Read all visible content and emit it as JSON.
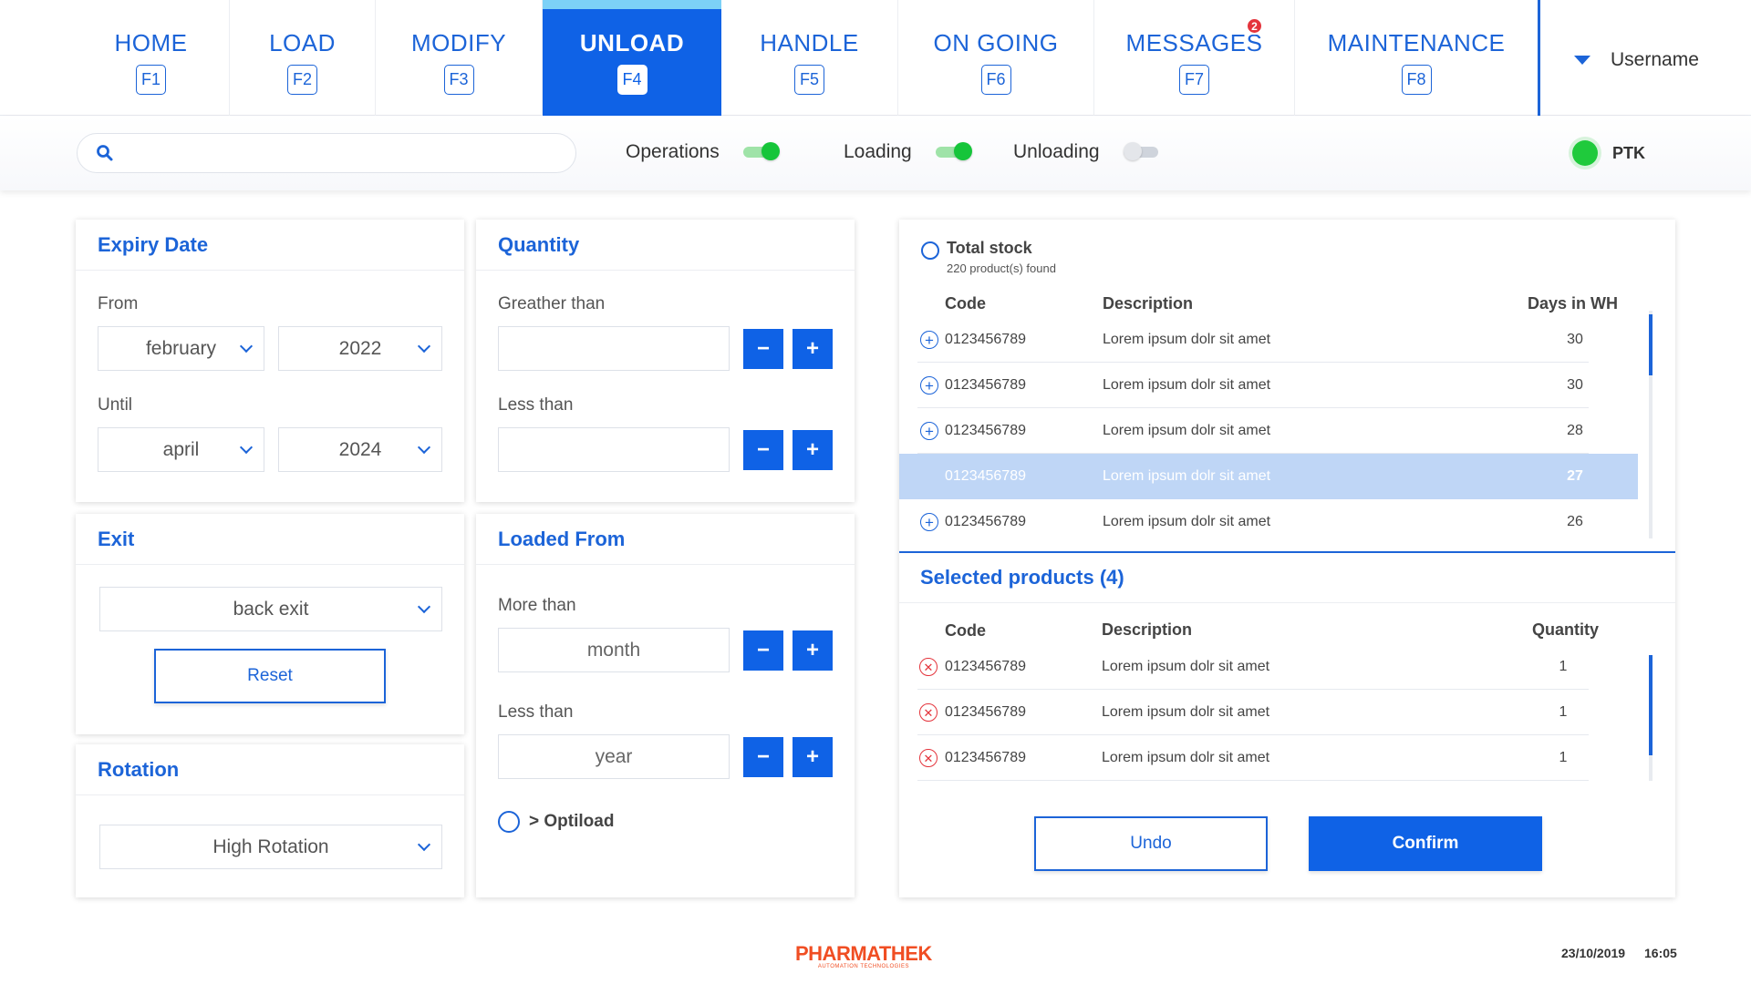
{
  "nav": {
    "tabs": [
      {
        "label": "HOME",
        "key": "F1"
      },
      {
        "label": "LOAD",
        "key": "F2"
      },
      {
        "label": "MODIFY",
        "key": "F3"
      },
      {
        "label": "UNLOAD",
        "key": "F4",
        "active": true
      },
      {
        "label": "HANDLE",
        "key": "F5"
      },
      {
        "label": "ON GOING",
        "key": "F6"
      },
      {
        "label": "MESSAGES",
        "key": "F7",
        "badge": "2"
      },
      {
        "label": "MAINTENANCE",
        "key": "F8"
      }
    ],
    "username": "Username"
  },
  "filterbar": {
    "search_placeholder": "",
    "toggles": [
      {
        "label": "Operations",
        "on": true
      },
      {
        "label": "Loading",
        "on": true
      },
      {
        "label": "Unloading",
        "on": false
      }
    ],
    "status_label": "PTK",
    "status_color": "#1fca3c"
  },
  "expiry": {
    "title": "Expiry Date",
    "from_label": "From",
    "from_month": "february",
    "from_year": "2022",
    "until_label": "Until",
    "until_month": "april",
    "until_year": "2024"
  },
  "quantity": {
    "title": "Quantity",
    "greater_label": "Greather than",
    "greater_value": "",
    "less_label": "Less than",
    "less_value": "",
    "minus": "−",
    "plus": "+"
  },
  "exit": {
    "title": "Exit",
    "value": "back exit",
    "reset_label": "Reset"
  },
  "rotation": {
    "title": "Rotation",
    "value": "High Rotation"
  },
  "loaded_from": {
    "title": "Loaded From",
    "more_label": "More than",
    "more_value": "month",
    "less_label": "Less than",
    "less_value": "year",
    "optiload_label": "> Optiload"
  },
  "stock": {
    "title": "Total stock",
    "found": "220 product(s) found",
    "headers": {
      "code": "Code",
      "description": "Description",
      "days": "Days in WH"
    },
    "rows": [
      {
        "code": "0123456789",
        "description": "Lorem ipsum dolr sit amet",
        "days": "30"
      },
      {
        "code": "0123456789",
        "description": "Lorem ipsum dolr sit amet",
        "days": "30"
      },
      {
        "code": "0123456789",
        "description": "Lorem ipsum dolr sit amet",
        "days": "28"
      },
      {
        "code": "0123456789",
        "description": "Lorem ipsum dolr sit amet",
        "days": "27",
        "selected": true
      },
      {
        "code": "0123456789",
        "description": "Lorem ipsum dolr sit amet",
        "days": "26"
      }
    ]
  },
  "selected": {
    "title": "Selected products (4)",
    "headers": {
      "code": "Code",
      "description": "Description",
      "quantity": "Quantity"
    },
    "rows": [
      {
        "code": "0123456789",
        "description": "Lorem ipsum dolr sit amet",
        "quantity": "1"
      },
      {
        "code": "0123456789",
        "description": "Lorem ipsum dolr sit amet",
        "quantity": "1"
      },
      {
        "code": "0123456789",
        "description": "Lorem ipsum dolr sit amet",
        "quantity": "1"
      }
    ],
    "undo_label": "Undo",
    "confirm_label": "Confirm"
  },
  "footer": {
    "brand": "PHARMATHEK",
    "tagline": "AUTOMATION TECHNOLOGIES",
    "date": "23/10/2019",
    "time": "16:05"
  },
  "colors": {
    "accent": "#0f62e6",
    "active_tab_top": "#7cd1f7",
    "danger": "#e4343c",
    "brand": "#f04e23",
    "ok": "#1fca3c"
  }
}
